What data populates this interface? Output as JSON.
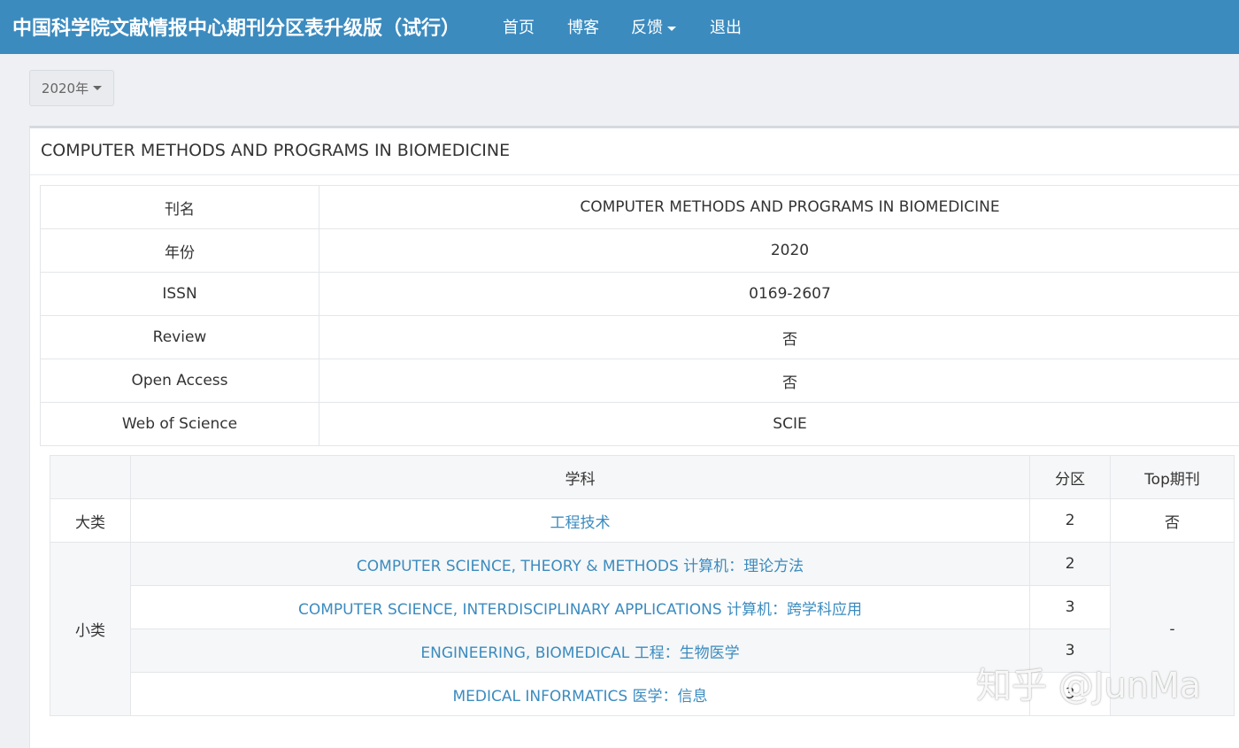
{
  "navbar": {
    "brand": "中国科学院文献情报中心期刊分区表升级版（试行）",
    "items": [
      "首页",
      "博客",
      "反馈",
      "退出"
    ]
  },
  "year_selector": {
    "label": "2020年"
  },
  "panel": {
    "title": "COMPUTER METHODS AND PROGRAMS IN BIOMEDICINE"
  },
  "info_table": [
    {
      "label": "刊名",
      "value": "COMPUTER METHODS AND PROGRAMS IN BIOMEDICINE"
    },
    {
      "label": "年份",
      "value": "2020"
    },
    {
      "label": "ISSN",
      "value": "0169-2607"
    },
    {
      "label": "Review",
      "value": "否"
    },
    {
      "label": "Open Access",
      "value": "否"
    },
    {
      "label": "Web of Science",
      "value": "SCIE"
    }
  ],
  "subject_table": {
    "headers": [
      "学科",
      "分区",
      "Top期刊"
    ],
    "major": {
      "label": "大类",
      "subject": "工程技术",
      "zone": "2",
      "top": "否"
    },
    "minor": {
      "label": "小类",
      "top": "-",
      "rows": [
        {
          "subject": "COMPUTER SCIENCE, THEORY & METHODS 计算机：理论方法",
          "zone": "2"
        },
        {
          "subject": "COMPUTER SCIENCE, INTERDISCIPLINARY APPLICATIONS 计算机：跨学科应用",
          "zone": "3"
        },
        {
          "subject": "ENGINEERING, BIOMEDICAL 工程：生物医学",
          "zone": "3"
        },
        {
          "subject": "MEDICAL INFORMATICS 医学：信息",
          "zone": "3"
        }
      ]
    }
  },
  "watermark": "知乎 @JunMa",
  "colors": {
    "navbar": "#3b8bbf",
    "link": "#3b8bbf",
    "page_bg": "#eef0f3"
  }
}
